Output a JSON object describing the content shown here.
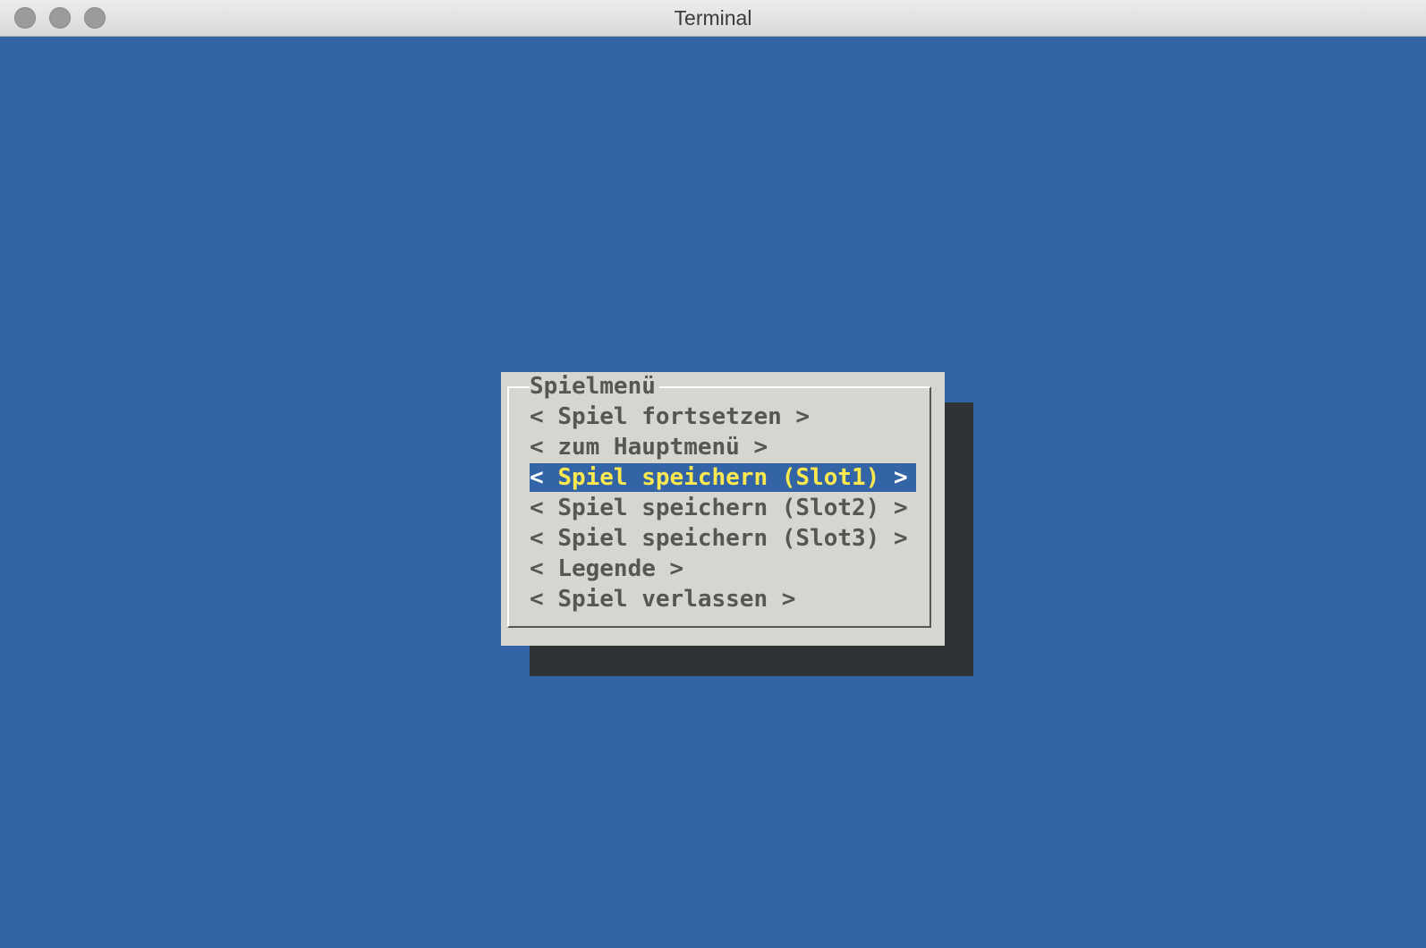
{
  "window": {
    "title": "Terminal"
  },
  "colors": {
    "background": "#3364a5",
    "dialog": "#d4d6cf",
    "shadow": "#2f3336",
    "text": "#555753",
    "selected_bg": "#3364a5",
    "selected_text": "#fce94f"
  },
  "dialog": {
    "title": "Spielmenü",
    "items": [
      {
        "label": "Spiel fortsetzen",
        "selected": false
      },
      {
        "label": "zum Hauptmenü",
        "selected": false
      },
      {
        "label": "Spiel speichern (Slot1)",
        "selected": true
      },
      {
        "label": "Spiel speichern (Slot2)",
        "selected": false
      },
      {
        "label": "Spiel speichern (Slot3)",
        "selected": false
      },
      {
        "label": "Legende",
        "selected": false
      },
      {
        "label": "Spiel verlassen",
        "selected": false
      }
    ],
    "left_marker": "<",
    "right_marker": ">"
  }
}
